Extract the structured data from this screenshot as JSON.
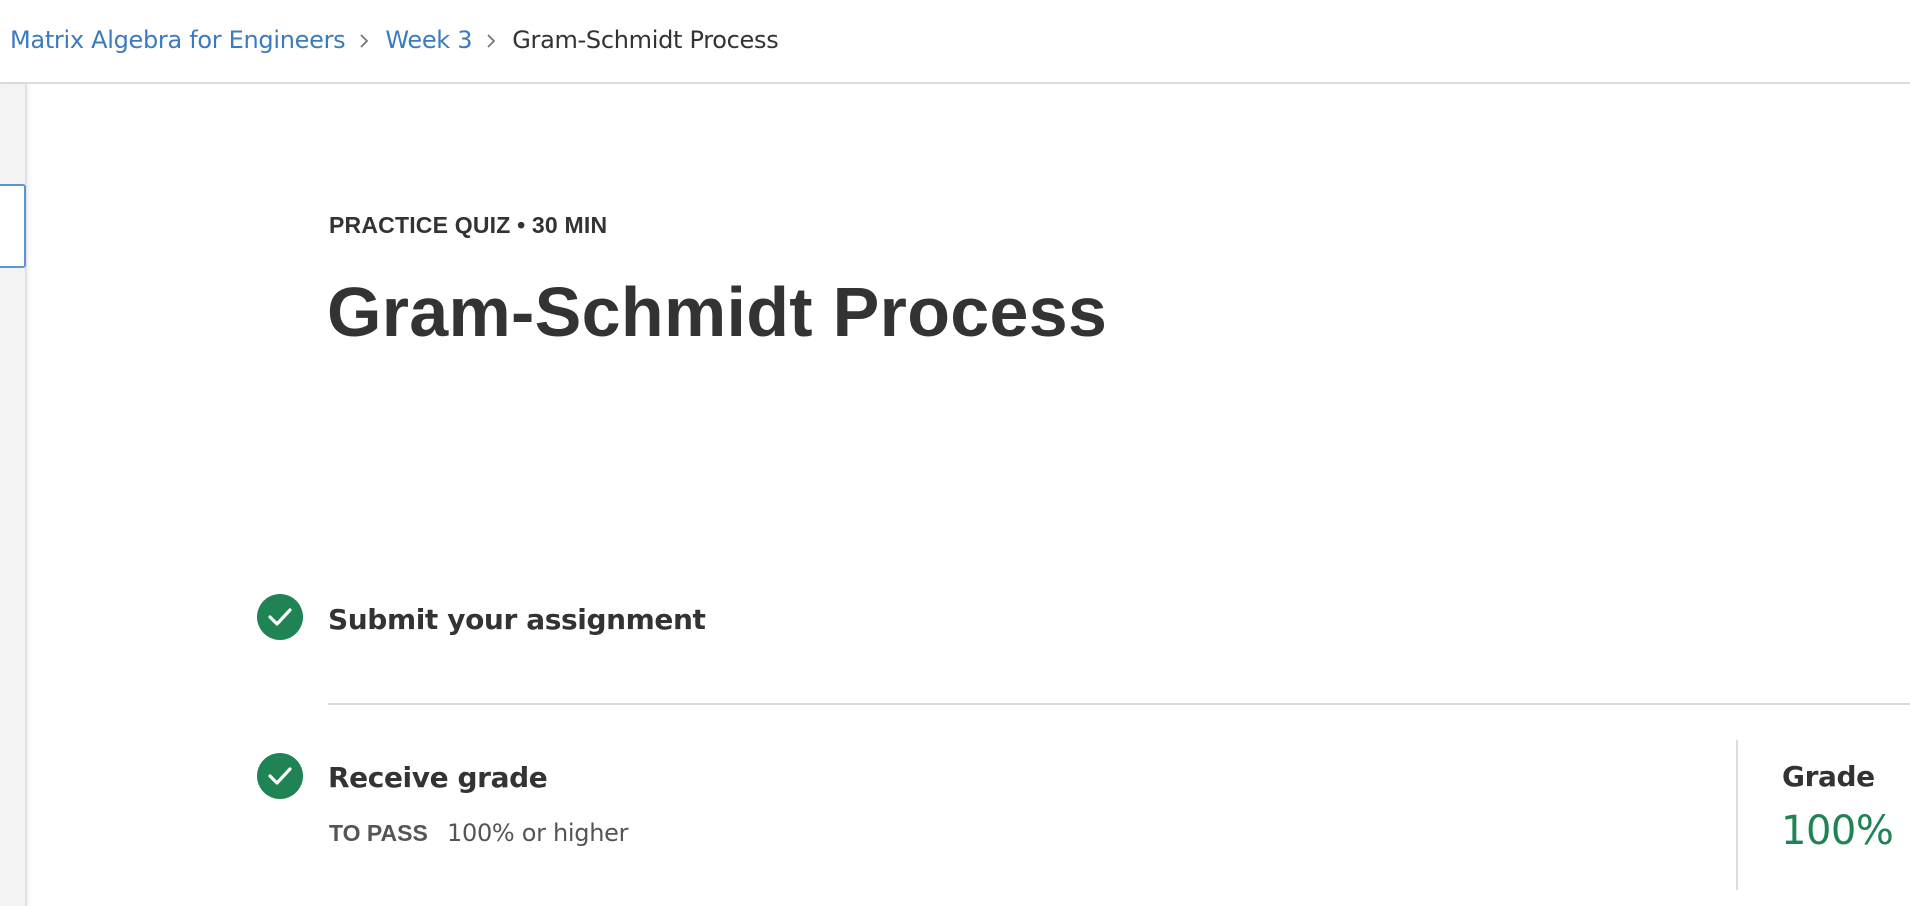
{
  "breadcrumb": {
    "course": "Matrix Algebra for Engineers",
    "week": "Week 3",
    "current": "Gram-Schmidt Process"
  },
  "quiz": {
    "eyebrow": "PRACTICE QUIZ • 30 MIN",
    "title": "Gram-Schmidt Process"
  },
  "steps": [
    {
      "title": "Submit your assignment",
      "status": "complete",
      "icon": "check-circle-icon"
    },
    {
      "title": "Receive grade",
      "status": "complete",
      "icon": "check-circle-icon",
      "pass_label": "TO PASS",
      "pass_value": "100% or higher"
    }
  ],
  "grade": {
    "label": "Grade",
    "value": "100%"
  },
  "colors": {
    "link": "#3b7bbf",
    "success": "#1f8354",
    "text": "#333333",
    "focus_border": "#5b95d6"
  }
}
